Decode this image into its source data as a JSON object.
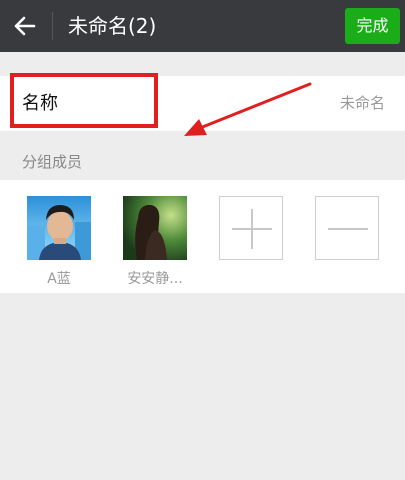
{
  "header": {
    "title": "未命名(2)",
    "done_label": "完成",
    "icons": {
      "back": "arrow-left-icon"
    }
  },
  "group_name": {
    "label": "名称",
    "value": "未命名"
  },
  "members_section": {
    "title": "分组成员",
    "members": [
      {
        "name": "A蓝"
      },
      {
        "name": "安安静..."
      }
    ],
    "icons": {
      "add": "plus-icon",
      "remove": "minus-icon"
    }
  },
  "colors": {
    "header_bg": "#393a3e",
    "accent": "#1aad19",
    "annotation": "#e02020",
    "background": "#ededed"
  }
}
